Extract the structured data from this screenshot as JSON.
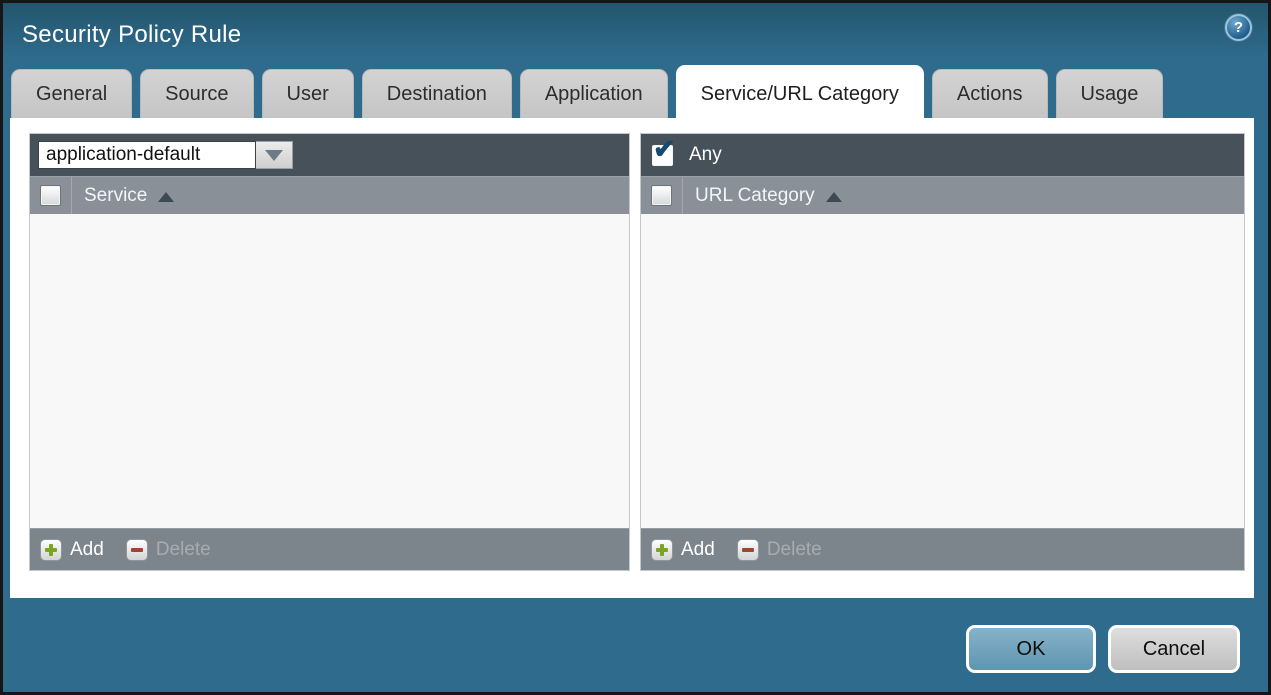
{
  "dialog": {
    "title": "Security Policy Rule"
  },
  "help_icon": {
    "glyph": "?"
  },
  "icons": {
    "checkmark": "✔"
  },
  "tabs": [
    {
      "label": "General",
      "active": false
    },
    {
      "label": "Source",
      "active": false
    },
    {
      "label": "User",
      "active": false
    },
    {
      "label": "Destination",
      "active": false
    },
    {
      "label": "Application",
      "active": false
    },
    {
      "label": "Service/URL Category",
      "active": true
    },
    {
      "label": "Actions",
      "active": false
    },
    {
      "label": "Usage",
      "active": false
    }
  ],
  "service_panel": {
    "dropdown_value": "application-default",
    "column_header": "Service",
    "sort_direction": "ascending",
    "rows": [],
    "header_checkbox_checked": false,
    "add_label": "Add",
    "delete_label": "Delete",
    "delete_enabled": false
  },
  "url_category_panel": {
    "any_label": "Any",
    "any_checked": true,
    "column_header": "URL Category",
    "sort_direction": "ascending",
    "rows": [],
    "header_checkbox_checked": false,
    "add_label": "Add",
    "delete_label": "Delete",
    "delete_enabled": false
  },
  "action_buttons": {
    "ok": "OK",
    "cancel": "Cancel"
  },
  "colors": {
    "background_teal": "#2e6b8c",
    "panel_bar_dark": "#46515a",
    "column_header_gray": "#899097",
    "footer_gray": "#7d858c",
    "panel_body": "#f8f8f8",
    "tab_inactive": "#cbcbcb",
    "tab_active": "#ffffff",
    "ok_button_blue": "#70a2be",
    "cancel_button_gray": "#d0d0d0",
    "add_icon_green": "#7ba51e",
    "delete_icon_red": "#9c4633",
    "checkmark_navy": "#174a70"
  }
}
